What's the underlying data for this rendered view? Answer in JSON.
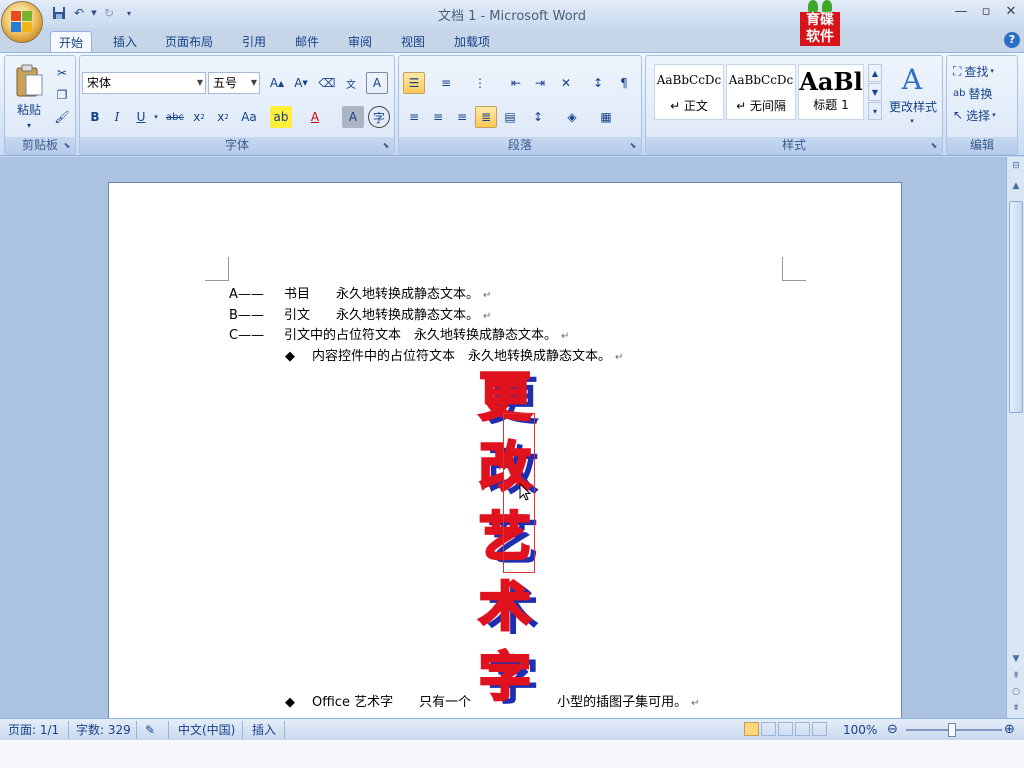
{
  "window": {
    "title": "文档 1 - Microsoft Word",
    "brand_text": "育碟软件"
  },
  "tabs": [
    {
      "label": "开始",
      "active": true
    },
    {
      "label": "插入"
    },
    {
      "label": "页面布局"
    },
    {
      "label": "引用"
    },
    {
      "label": "邮件"
    },
    {
      "label": "审阅"
    },
    {
      "label": "视图"
    },
    {
      "label": "加载项"
    }
  ],
  "ribbon": {
    "clipboard": {
      "label": "剪贴板",
      "paste": "粘贴"
    },
    "font": {
      "label": "字体",
      "font_name": "宋体",
      "font_size": "五号"
    },
    "paragraph": {
      "label": "段落"
    },
    "styles": {
      "label": "样式",
      "items": [
        {
          "preview": "AaBbCcDc",
          "name": "↵ 正文"
        },
        {
          "preview": "AaBbCcDc",
          "name": "↵ 无间隔"
        },
        {
          "preview": "AaBl",
          "name": "标题 1"
        }
      ],
      "change_styles": "更改样式"
    },
    "editing": {
      "label": "编辑",
      "find": "查找",
      "replace": "替换",
      "select": "选择"
    }
  },
  "document": {
    "lines": [
      {
        "prefix": "A——",
        "text": "书目　　永久地转换成静态文本。"
      },
      {
        "prefix": "B——",
        "text": "引文　　永久地转换成静态文本。"
      },
      {
        "prefix": "C——",
        "text": "引文中的占位符文本　永久地转换成静态文本。"
      },
      {
        "prefix": "◆",
        "text": "内容控件中的占位符文本　永久地转换成静态文本。"
      }
    ],
    "wordart_chars": [
      "更",
      "改",
      "艺",
      "术",
      "字"
    ],
    "bottom_line": {
      "prefix": "◆",
      "text_left": "Office 艺术字　　只有一个",
      "text_right": "小型的插图子集可用。"
    }
  },
  "status_bar": {
    "page": "页面: 1/1",
    "words": "字数: 329",
    "language": "中文(中国)",
    "mode": "插入",
    "zoom": "100%"
  }
}
